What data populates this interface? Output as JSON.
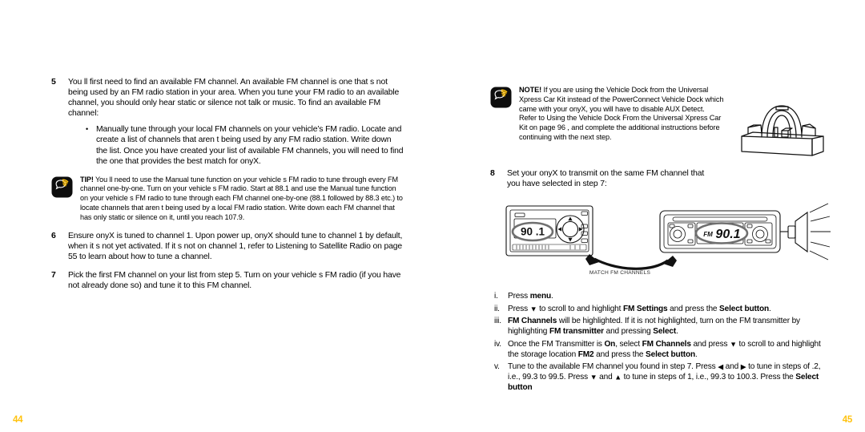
{
  "document": {
    "type": "user-manual-spread",
    "accent_color": "#FFC20E",
    "text_color": "#000000",
    "background": "#FFFFFF"
  },
  "left_page": {
    "folio": "44",
    "steps": [
      {
        "number": "5",
        "text": "You ll first need to find an available FM channel. An available FM channel is one that s not being used by an FM radio station in your area. When you tune your FM radio to an available channel, you should only hear static or silence   not talk or music. To find an available FM channel:",
        "bullets": [
          "Manually tune through your local FM channels on your vehicle’s FM radio. Locate and create a list of channels that aren t being used by any FM radio station. Write down the list.  Once you have created your list of available FM channels, you will need to find the one that provides the best match for onyX."
        ]
      },
      {
        "number": "6",
        "text": "Ensure onyX is tuned to channel 1. Upon power up, onyX should tune to channel 1 by default, when it s not yet activated. If it s not on channel 1, refer to  Listening to Satellite Radio  on page 55 to learn about how to tune a channel."
      },
      {
        "number": "7",
        "text": "Pick the first FM channel on your list from step 5. Turn on your vehicle s FM radio (if you have not already done so) and tune it to this FM channel."
      }
    ],
    "tip": {
      "icon": "speech-bubble-tip-icon",
      "label": "TIP!",
      "text": " You ll need to use the  Manual  tune function on your vehicle s FM radio to tune through every FM channel one-by-one. Turn on your vehicle s FM radio.  Start at 88.1 and use the  Manual  tune function on your vehicle s FM radio to tune through each FM channel one-by-one (88.1 followed by 88.3 etc.) to locate channels that aren t being used by a local FM radio station. Write down each FM channel that has only static or silence on it, until you reach 107.9."
    }
  },
  "right_page": {
    "folio": "45",
    "note": {
      "icon": "speech-bubble-note-icon",
      "label": "NOTE!",
      "text": " If you are using the Vehicle Dock from the Universal Xpress Car Kit instead of the PowerConnect Vehicle Dock which came with your onyX, you will have to disable AUX Detect. Refer to  Using the Vehicle Dock From the Universal Xpress Car Kit  on page 96 , and complete the additional instructions before continuing with the next step."
    },
    "dock_illustration": {
      "name": "vehicle-dock-illustration",
      "alt": "Line drawing of a vehicle dock cradle"
    },
    "step": {
      "number": "8",
      "text": "Set your onyX to transmit on the same FM channel that you have selected in step 7:"
    },
    "diagram": {
      "name": "match-fm-channels-diagram",
      "caption": "MATCH FM CHANNELS",
      "onyx_display": "90 .1",
      "car_stereo_band": "FM",
      "car_stereo_display": "90.1"
    },
    "substeps": [
      {
        "numeral": "i.",
        "parts": [
          {
            "t": "Press "
          },
          {
            "t": "menu",
            "b": true
          },
          {
            "t": "."
          }
        ]
      },
      {
        "numeral": "ii.",
        "parts": [
          {
            "t": "Press "
          },
          {
            "t": "▼",
            "arrow": true
          },
          {
            "t": " to scroll to and highlight "
          },
          {
            "t": "FM Settings",
            "b": true
          },
          {
            "t": " and press the "
          },
          {
            "t": "Select button",
            "b": true
          },
          {
            "t": "."
          }
        ]
      },
      {
        "numeral": "iii.",
        "parts": [
          {
            "t": "FM Channels",
            "b": true
          },
          {
            "t": " will be highlighted. If it is not highlighted, turn on the FM transmitter by highlighting "
          },
          {
            "t": "FM transmitter",
            "b": true
          },
          {
            "t": " and pressing "
          },
          {
            "t": "Select",
            "b": true
          },
          {
            "t": "."
          }
        ]
      },
      {
        "numeral": "iv.",
        "parts": [
          {
            "t": "Once the FM Transmitter is "
          },
          {
            "t": "On",
            "b": true
          },
          {
            "t": ", select "
          },
          {
            "t": "FM Channels",
            "b": true
          },
          {
            "t": " and press "
          },
          {
            "t": "▼",
            "arrow": true
          },
          {
            "t": " to scroll to and highlight the storage location "
          },
          {
            "t": "FM2",
            "b": true
          },
          {
            "t": " and press the "
          },
          {
            "t": "Select button",
            "b": true
          },
          {
            "t": "."
          }
        ]
      },
      {
        "numeral": "v.",
        "parts": [
          {
            "t": "Tune to the available FM channel you found in step 7. Press "
          },
          {
            "t": "◀",
            "arrow": true
          },
          {
            "t": " and "
          },
          {
            "t": "▶",
            "arrow": true
          },
          {
            "t": " to tune in steps of .2, i.e., 99.3 to 99.5. Press "
          },
          {
            "t": "▼",
            "arrow": true
          },
          {
            "t": " and "
          },
          {
            "t": "▲",
            "arrow": true
          },
          {
            "t": " to tune in steps of 1, i.e., 99.3 to 100.3. Press the "
          },
          {
            "t": "Select button",
            "b": true
          }
        ]
      }
    ]
  }
}
